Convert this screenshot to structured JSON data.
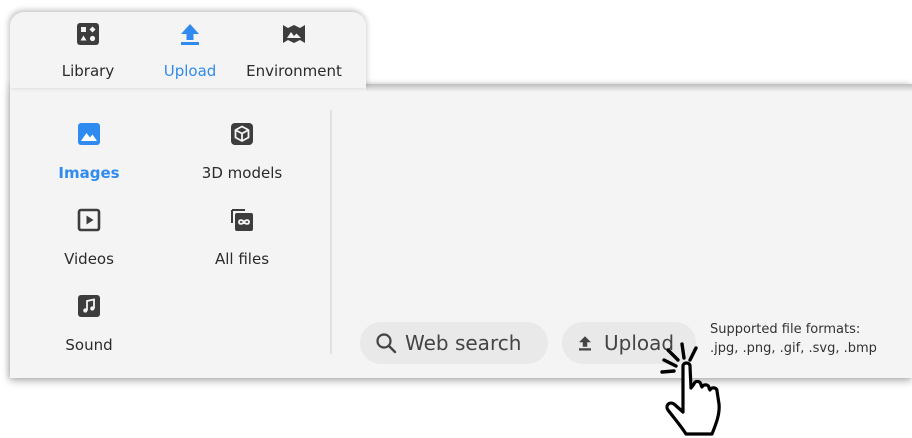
{
  "tabs": [
    {
      "label": "Library",
      "icon": "library-icon",
      "active": false
    },
    {
      "label": "Upload",
      "icon": "upload-icon",
      "active": true
    },
    {
      "label": "Environment",
      "icon": "environment-icon",
      "active": false
    }
  ],
  "categories": [
    {
      "label": "Images",
      "icon": "images-icon",
      "active": true
    },
    {
      "label": "3D models",
      "icon": "3d-models-icon",
      "active": false
    },
    {
      "label": "Videos",
      "icon": "videos-icon",
      "active": false
    },
    {
      "label": "All files",
      "icon": "all-files-icon",
      "active": false
    },
    {
      "label": "Sound",
      "icon": "sound-icon",
      "active": false
    }
  ],
  "actions": {
    "web_search_label": "Web search",
    "upload_label": "Upload"
  },
  "formats": {
    "title": "Supported file formats:",
    "list": ".jpg, .png, .gif, .svg, .bmp"
  },
  "colors": {
    "accent": "#2f8bf0",
    "icon_dark": "#3d3d3d",
    "panel_bg": "#f4f4f4",
    "pill_bg": "#e9e9e9"
  }
}
